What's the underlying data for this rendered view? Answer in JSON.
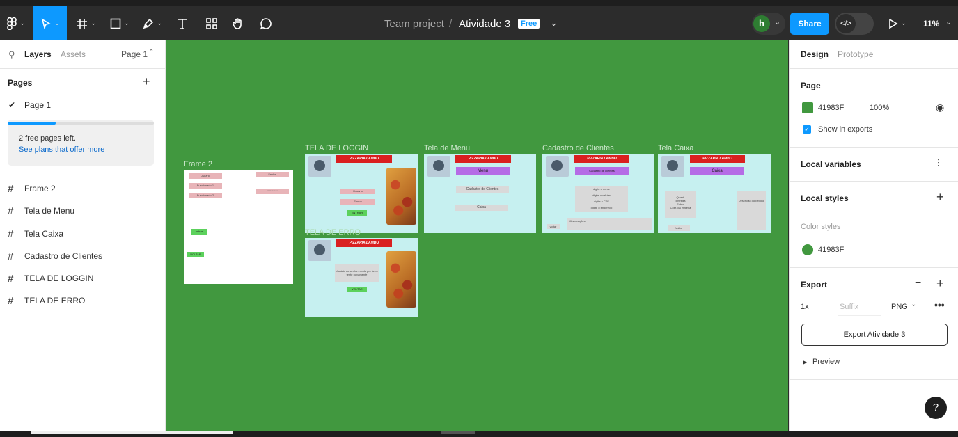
{
  "toolbar": {
    "project": "Team project",
    "separator": "/",
    "file_name": "Atividade 3",
    "plan_badge": "Free",
    "avatar_initial": "h",
    "share_label": "Share",
    "zoom": "11%"
  },
  "left_panel": {
    "tabs": {
      "layers": "Layers",
      "assets": "Assets"
    },
    "page_selector": "Page 1",
    "pages_title": "Pages",
    "pages": [
      {
        "label": "Page 1",
        "selected": true
      }
    ],
    "free_pages_progress": 0.33,
    "free_pages_text": "2 free pages left.",
    "plans_link": "See plans that offer more",
    "layers": [
      "Frame 2",
      "Tela de Menu",
      "Tela Caixa",
      "Cadastro de Clientes",
      "TELA DE LOGGIN",
      "TELA DE ERRO"
    ]
  },
  "canvas": {
    "bg_color": "#41983F",
    "frames": {
      "frame2": {
        "label": "Frame 2",
        "fields": [
          "Usuario",
          "Funcionario 1",
          "Funcionario 2"
        ],
        "right_top": "Senha",
        "right_bottom": "**********",
        "btn1": "entrar",
        "btn2": "VOLTAR"
      },
      "loggin": {
        "label": "TELA DE LOGGIN",
        "header": "PIZZARIA LAMBO",
        "user": "Usuário",
        "pass": "Senha",
        "btn": "ENTRAR"
      },
      "erro": {
        "label": "TELA DE ERRO",
        "header": "PIZZARIA LAMBO",
        "msg": "Usuário ou senha errada por favor tente novamente",
        "btn": "VOLTAR"
      },
      "menu": {
        "label": "Tela de Menu",
        "header": "PIZZARIA LAMBO",
        "title": "Menu",
        "opt1": "Cadastro de Clientes",
        "opt2": "Caixa"
      },
      "cadastro": {
        "label": "Cadastro de Clientes",
        "header": "PIZZARIA LAMBO",
        "title": "Cadastro de clientes",
        "fields": [
          "digite o nome",
          "digite o celular",
          "digite o CPF",
          "digite o endereço"
        ],
        "obs": "Observações",
        "btn": "voltar"
      },
      "caixa": {
        "label": "Tela Caixa",
        "header": "PIZZARIA LAMBO",
        "title": "Caixa",
        "left_lines": [
          "Quant.",
          "Entrega",
          "Sabor",
          "Cobr. da entrega"
        ],
        "right_text": "Descrição do pedido",
        "btn": "Voltar"
      }
    }
  },
  "right_panel": {
    "tabs": {
      "design": "Design",
      "prototype": "Prototype"
    },
    "page_title": "Page",
    "page_color": "#41983F",
    "page_color_hex": "41983F",
    "page_opacity": "100%",
    "show_in_exports": "Show in exports",
    "local_variables": "Local variables",
    "local_styles": "Local styles",
    "color_styles": "Color styles",
    "style_hex": "41983F",
    "export_title": "Export",
    "export_scale": "1x",
    "suffix_placeholder": "Suffix",
    "format": "PNG",
    "export_button": "Export Atividade 3",
    "preview": "Preview"
  },
  "help": "?"
}
